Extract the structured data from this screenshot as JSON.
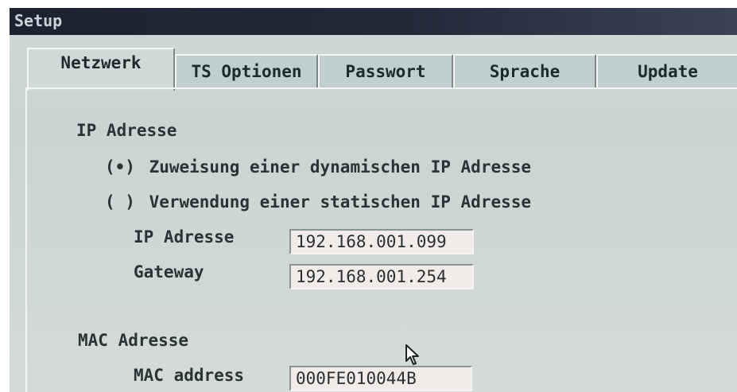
{
  "window": {
    "title": "Setup"
  },
  "tabs": [
    {
      "label": "Netzwerk",
      "active": true
    },
    {
      "label": "TS Optionen",
      "active": false
    },
    {
      "label": "Passwort",
      "active": false
    },
    {
      "label": "Sprache",
      "active": false
    },
    {
      "label": "Update",
      "active": false
    }
  ],
  "network": {
    "ip_section_label": "IP Adresse",
    "radio_dynamic": {
      "marker": "(•)",
      "label": "Zuweisung einer dynamischen IP Adresse",
      "selected": true
    },
    "radio_static": {
      "marker": "( )",
      "label": "Verwendung einer statischen IP Adresse",
      "selected": false
    },
    "ip_label": "IP Adresse",
    "ip_value": "192.168.001.099",
    "gateway_label": "Gateway",
    "gateway_value": "192.168.001.254",
    "mac_section_label": "MAC Adresse",
    "mac_label": "MAC address",
    "mac_value": "000FE010044B"
  },
  "colors": {
    "titlebar": "#1c2230",
    "panel": "#cfd8d6",
    "field": "#f1ecea"
  },
  "icons": {
    "pointer": "mouse-pointer-icon"
  }
}
